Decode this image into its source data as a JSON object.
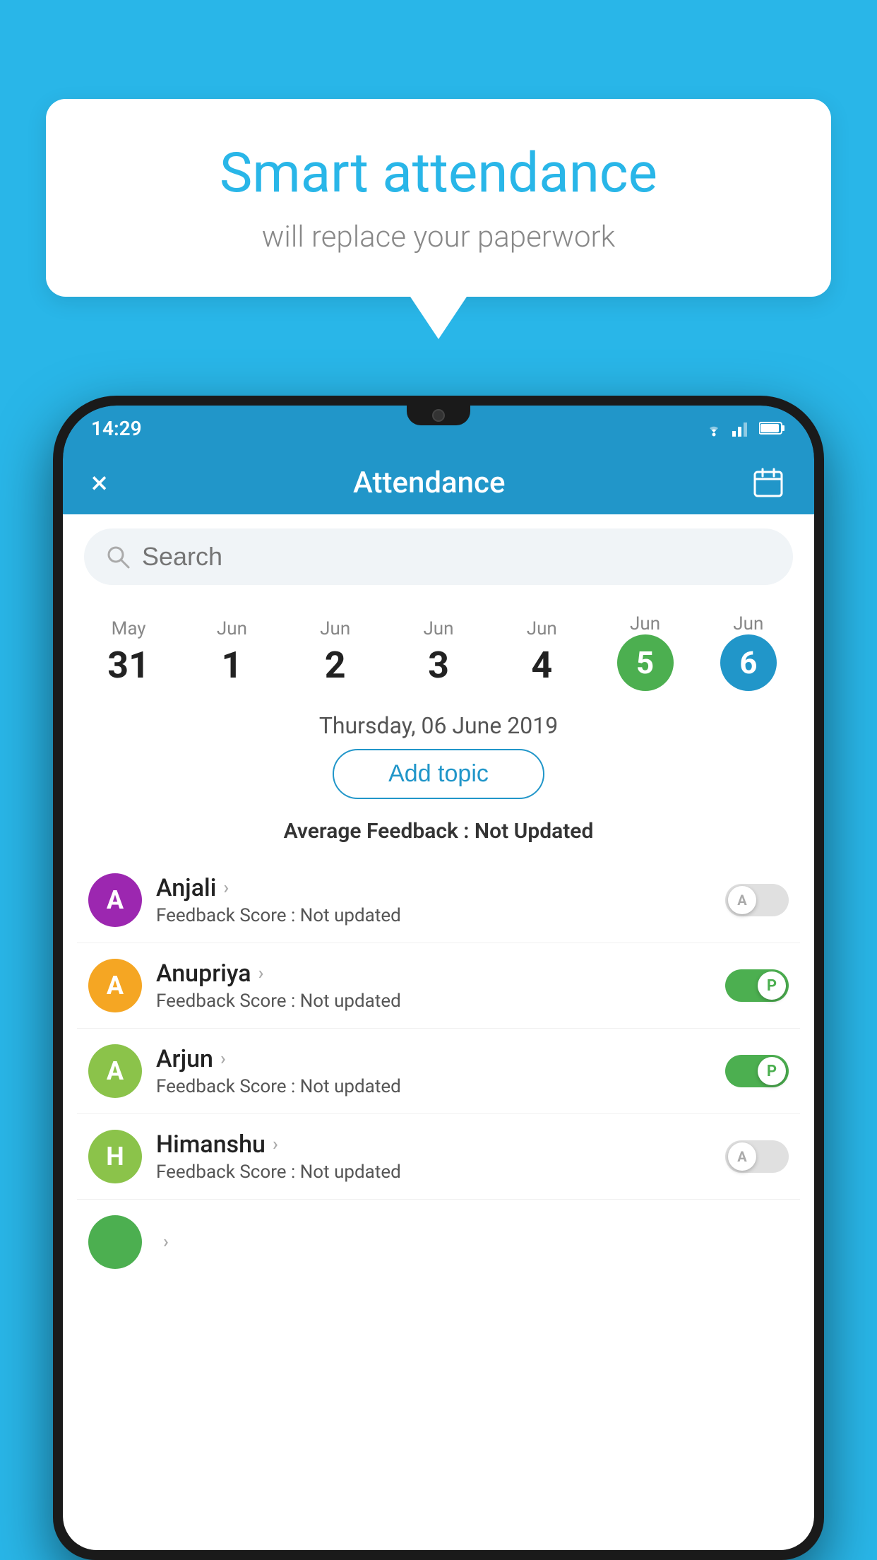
{
  "background_color": "#29b6e8",
  "bubble": {
    "title": "Smart attendance",
    "subtitle": "will replace your paperwork"
  },
  "status_bar": {
    "time": "14:29",
    "wifi_icon": "wifi-icon",
    "signal_icon": "signal-icon",
    "battery_icon": "battery-icon"
  },
  "header": {
    "title": "Attendance",
    "close_label": "×",
    "calendar_icon": "calendar-icon"
  },
  "search": {
    "placeholder": "Search"
  },
  "calendar": {
    "days": [
      {
        "month": "May",
        "date": "31",
        "selected": ""
      },
      {
        "month": "Jun",
        "date": "1",
        "selected": ""
      },
      {
        "month": "Jun",
        "date": "2",
        "selected": ""
      },
      {
        "month": "Jun",
        "date": "3",
        "selected": ""
      },
      {
        "month": "Jun",
        "date": "4",
        "selected": ""
      },
      {
        "month": "Jun",
        "date": "5",
        "selected": "green"
      },
      {
        "month": "Jun",
        "date": "6",
        "selected": "blue"
      }
    ],
    "selected_date_label": "Thursday, 06 June 2019"
  },
  "add_topic_label": "Add topic",
  "feedback_summary": {
    "label": "Average Feedback : ",
    "value": "Not Updated"
  },
  "students": [
    {
      "name": "Anjali",
      "avatar_letter": "A",
      "avatar_color": "#9c27b0",
      "feedback_label": "Feedback Score : ",
      "feedback_value": "Not updated",
      "attendance": "A",
      "toggle_on": false
    },
    {
      "name": "Anupriya",
      "avatar_letter": "A",
      "avatar_color": "#f5a623",
      "feedback_label": "Feedback Score : ",
      "feedback_value": "Not updated",
      "attendance": "P",
      "toggle_on": true
    },
    {
      "name": "Arjun",
      "avatar_letter": "A",
      "avatar_color": "#8bc34a",
      "feedback_label": "Feedback Score : ",
      "feedback_value": "Not updated",
      "attendance": "P",
      "toggle_on": true
    },
    {
      "name": "Himanshu",
      "avatar_letter": "H",
      "avatar_color": "#8bc34a",
      "feedback_label": "Feedback Score : ",
      "feedback_value": "Not updated",
      "attendance": "A",
      "toggle_on": false
    }
  ]
}
